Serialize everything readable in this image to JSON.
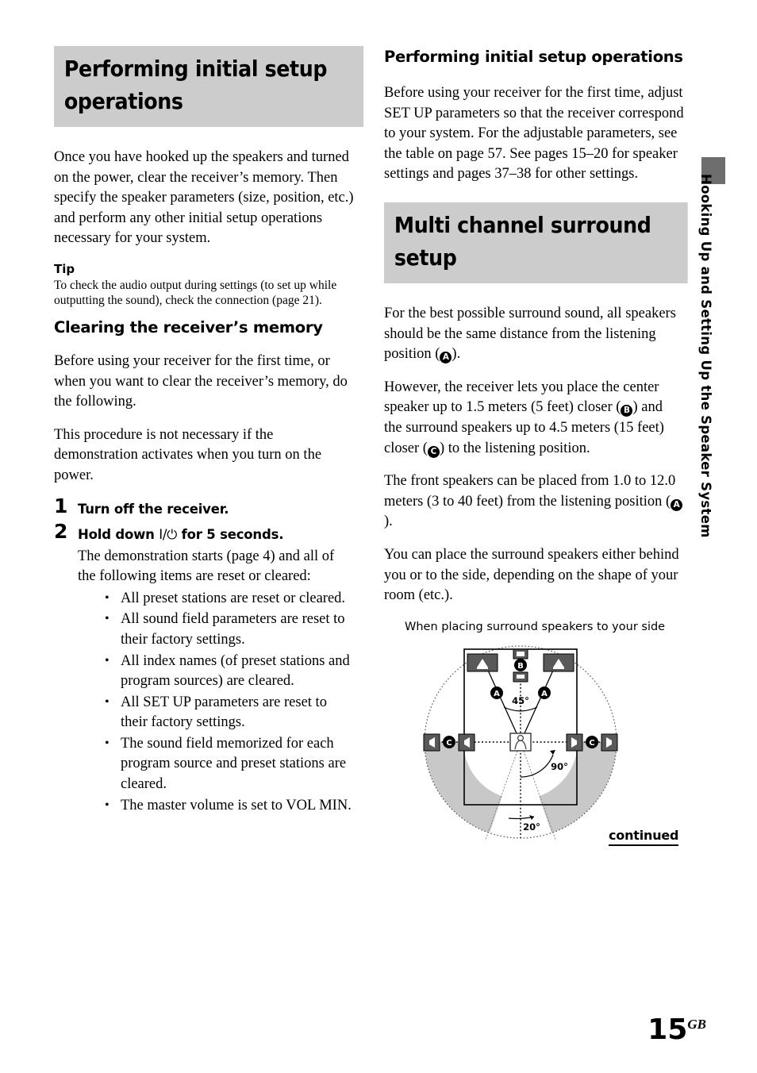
{
  "left_column": {
    "heading": "Performing initial setup operations",
    "intro": "Once you have hooked up the speakers and turned on the power, clear the receiver’s memory. Then specify the speaker parameters (size, position, etc.) and perform any other initial setup operations necessary for your system.",
    "tip_label": "Tip",
    "tip_body": "To check the audio output during settings (to set up while outputting the sound), check the connection (page 21).",
    "subheading": "Clearing the receiver’s memory",
    "para1": "Before using your receiver for the first time, or when you want to clear the receiver’s memory, do the following.",
    "para2": "This procedure is not necessary if the demonstration activates when you turn on the power.",
    "steps": [
      {
        "number": "1",
        "title": "Turn off the receiver."
      },
      {
        "number": "2",
        "title_before": "Hold down ",
        "power_symbol": "I/⏻",
        "title_after": " for 5 seconds.",
        "body": "The demonstration starts (page 4) and all of the following items are reset or cleared:",
        "bullets": [
          "All preset stations are reset or cleared.",
          "All sound field parameters are reset to their factory settings.",
          "All index names (of preset stations and program sources) are cleared.",
          "All SET UP parameters are reset to their factory settings.",
          "The sound field memorized for each program source and preset stations are cleared.",
          "The master volume is set to VOL MIN."
        ]
      }
    ]
  },
  "right_column": {
    "subheading": "Performing initial setup operations",
    "intro": "Before using your receiver for the first time, adjust SET UP parameters so that the receiver correspond to your system. For the adjustable parameters, see the table on page 57. See pages 15–20 for speaker settings and pages 37–38 for other settings.",
    "heading": "Multi channel surround setup",
    "para1_a": "For the best possible surround sound, all speakers should be the same distance from the listening position (",
    "para1_circle": "A",
    "para1_b": ").",
    "para2_a": "However, the receiver lets you place the center speaker up to 1.5 meters (5 feet) closer (",
    "para2_circle1": "B",
    "para2_b": ") and the surround speakers up to 4.5 meters  (15 feet) closer (",
    "para2_circle2": "C",
    "para2_c": ") to the listening position.",
    "para3_a": "The front speakers can be placed from 1.0 to 12.0 meters (3 to 40 feet) from the listening position (",
    "para3_circle": "A",
    "para3_b": ").",
    "para4": "You can place the surround speakers either behind you or to the side, depending on the shape of your room (etc.).",
    "figure_caption": "When placing surround speakers to your side"
  },
  "figure": {
    "angles": {
      "front": "45°",
      "side": "90°",
      "rear": "20°"
    },
    "labels": {
      "front_left": "A",
      "front_right": "A",
      "center": "B",
      "surround_left": "C",
      "surround_right": "C"
    },
    "colors": {
      "speaker_fill": "#595959",
      "shaded_zone": "#c8c8c8",
      "outline": "#000000"
    }
  },
  "footer": {
    "continued": "continued",
    "page_number": "15",
    "page_suffix": "GB"
  },
  "side_tab": {
    "text": "Hooking Up and Setting Up the Speaker System",
    "bar_color": "#6e6e6e"
  }
}
